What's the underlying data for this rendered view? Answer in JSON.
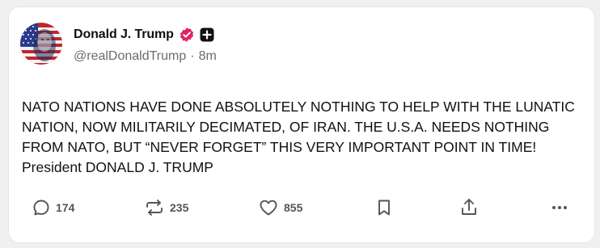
{
  "post": {
    "author": {
      "name": "Donald J. Trump",
      "handle": "@realDonaldTrump",
      "separator": "·",
      "time_ago": "8m"
    },
    "text": "NATO NATIONS HAVE DONE ABSOLUTELY NOTHING TO HELP WITH THE LUNATIC NATION, NOW MILITARILY DECIMATED, OF IRAN. THE U.S.A. NEEDS NOTHING FROM NATO, BUT “NEVER FORGET” THIS VERY IMPORTANT POINT IN TIME! President DONALD J. TRUMP",
    "actions": {
      "replies": "174",
      "reposts": "235",
      "likes": "855"
    }
  },
  "icons": {
    "verified": "verified-badge-icon",
    "plus": "plus-icon",
    "reply": "comment-icon",
    "repost": "repost-icon",
    "like": "heart-icon",
    "bookmark": "bookmark-icon",
    "share": "share-icon",
    "more": "more-icon"
  },
  "colors": {
    "verified": "#e0245e",
    "icon": "#555555",
    "handle": "#6b6b6b"
  }
}
